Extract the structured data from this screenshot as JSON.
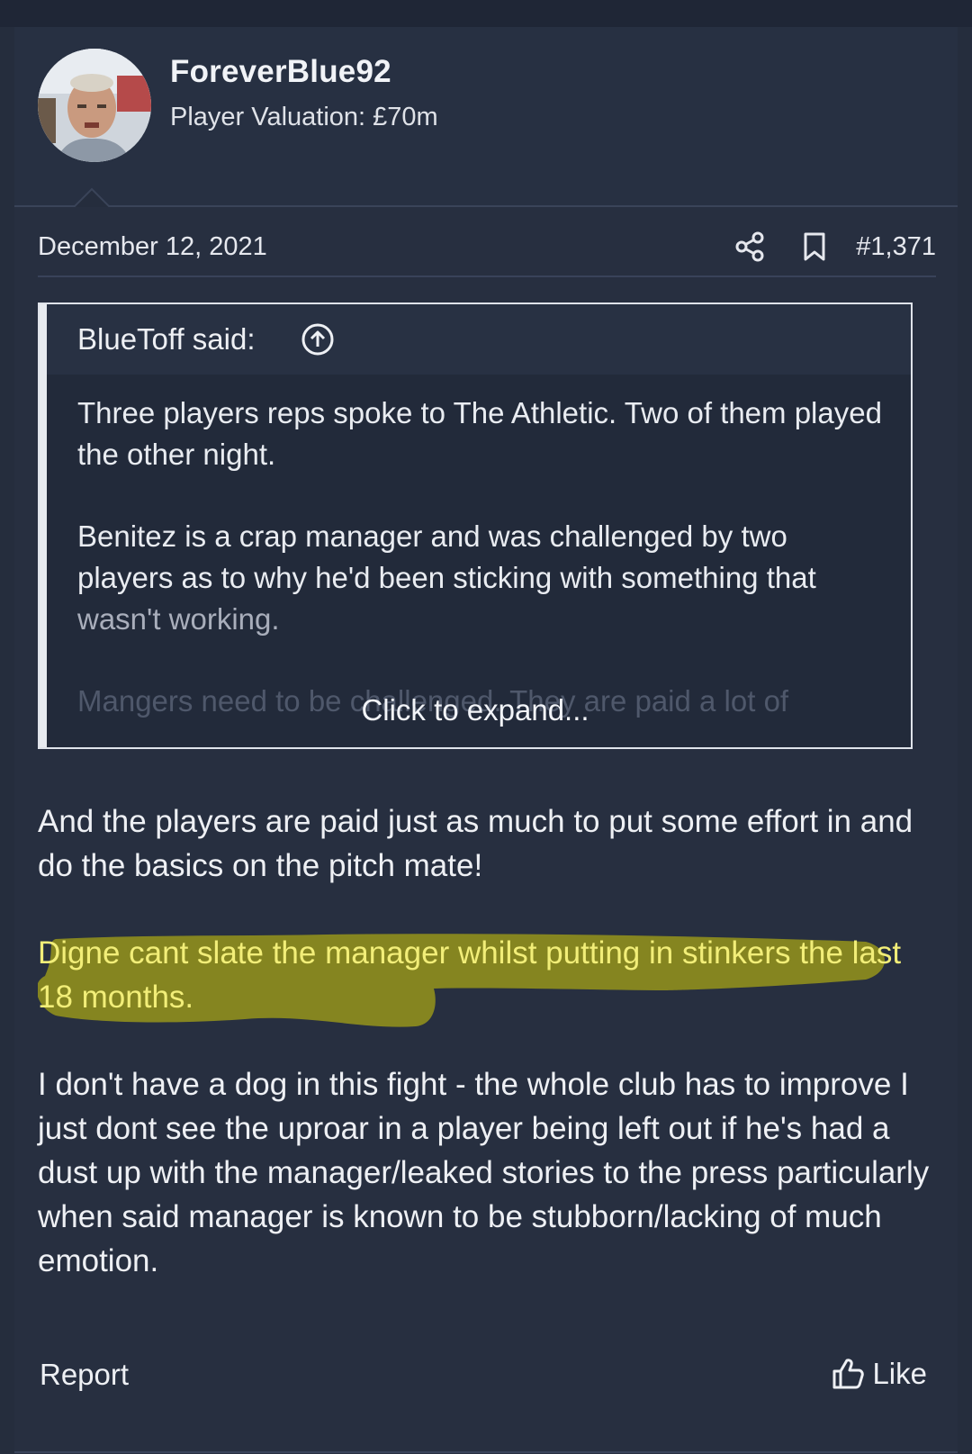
{
  "post": {
    "author": {
      "username": "ForeverBlue92",
      "valuation": "Player Valuation: £70m"
    },
    "date": "December 12, 2021",
    "number": "#1,371",
    "icons": {
      "share": "share-icon",
      "bookmark": "bookmark-icon",
      "quote_jump": "arrow-up-circle-icon",
      "like": "thumbs-up-icon"
    },
    "quote": {
      "author_label": "BlueToff said:",
      "paragraphs": [
        "Three players reps spoke to The Athletic. Two of them played the other night.",
        "Benitez is a crap manager and was challenged by two players as to why he'd been sticking with something that",
        "wasn't working.",
        "Mangers need to be challenged. They are paid a lot of"
      ],
      "expand_label": "Click to expand..."
    },
    "body": {
      "paragraphs": [
        "And the players are paid just as much to put some effort in and do the basics on the pitch mate!",
        "Digne cant slate the manager whilst putting in stinkers the last 18 months.",
        "I don't have a dog in this fight - the whole club has to improve I just dont see the uproar in a player being left out if he's had a dust up with the manager/leaked stories to the press particularly when said manager is known to be stubborn/lacking of much emotion."
      ]
    },
    "actions": {
      "report_label": "Report",
      "like_label": "Like"
    },
    "colors": {
      "background": "#252d3d",
      "highlight": "#8a8a1f",
      "highlight_text": "#f2ee78"
    }
  }
}
